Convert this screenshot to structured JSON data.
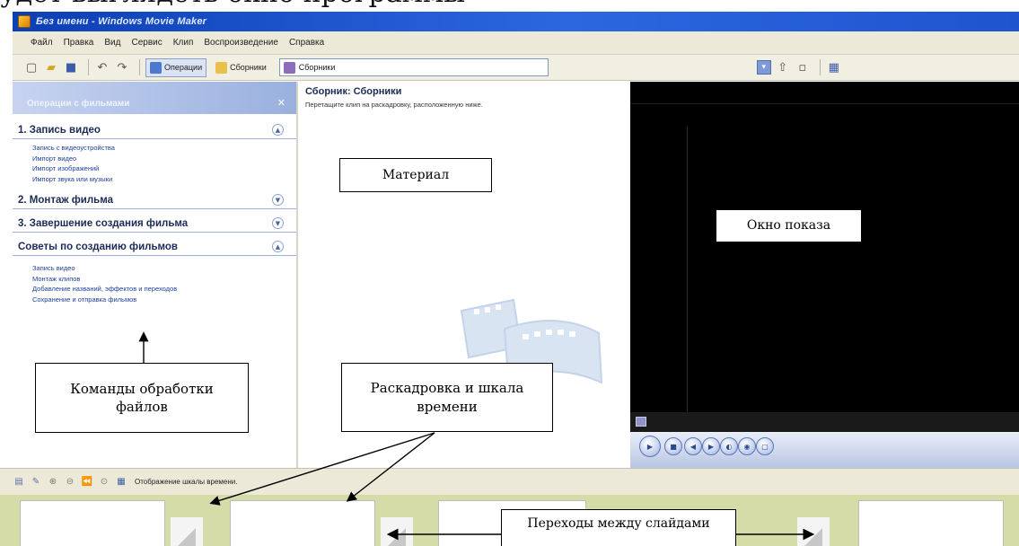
{
  "window": {
    "title": "Без имени - Windows Movie Maker"
  },
  "menu": [
    "Файл",
    "Правка",
    "Вид",
    "Сервис",
    "Клип",
    "Воспроизведение",
    "Справка"
  ],
  "toolbar": {
    "tasks_button": "Операции",
    "collections_button": "Сборники",
    "collection_select": "Сборники"
  },
  "tasks": {
    "header": "Операции с фильмами",
    "sections": [
      {
        "title": "1. Запись видео",
        "links": [
          "Запись с видеоустройства",
          "Импорт видео",
          "Импорт изображений",
          "Импорт звука или музыки"
        ]
      },
      {
        "title": "2. Монтаж фильма",
        "links": []
      },
      {
        "title": "3. Завершение создания фильма",
        "links": []
      },
      {
        "title": "Советы по созданию фильмов",
        "links": [
          "Запись видео",
          "Монтаж клипов",
          "Добавление названий, эффектов и переходов",
          "Сохранение и отправка фильмов"
        ]
      }
    ]
  },
  "collection": {
    "title": "Сборник: Сборники",
    "subtitle": "Перетащите клип на раскадровку, расположенную ниже."
  },
  "storyboard": {
    "toolbar_label": "Отображение шкалы времени."
  },
  "callouts": {
    "material": "Материал",
    "preview": "Окно показа",
    "commands": "Команды обработки файлов",
    "storyboard": "Раскадровка и шкала времени",
    "transitions": "Переходы между слайдами"
  },
  "top_cut_text": "удет выглядеть окно программы"
}
